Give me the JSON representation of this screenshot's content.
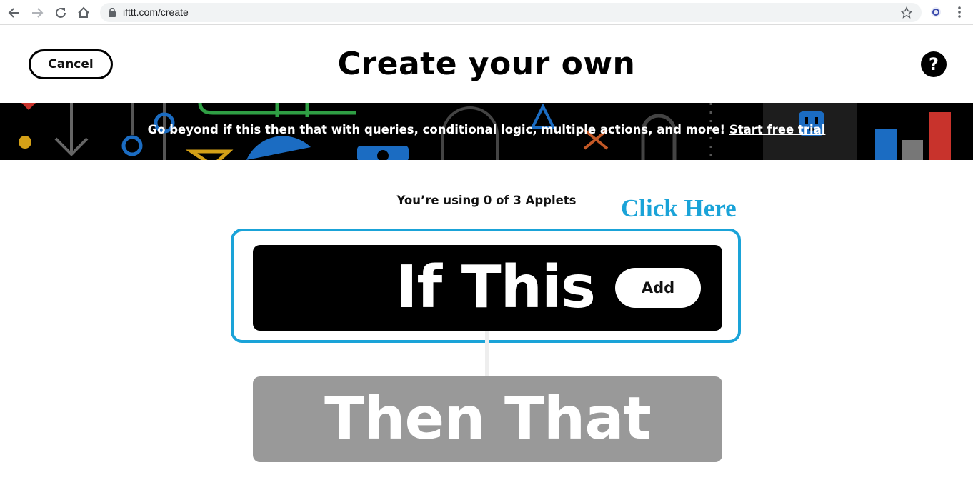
{
  "browser": {
    "url": "ifttt.com/create",
    "icons": [
      "back-icon",
      "forward-icon",
      "reload-icon",
      "home-icon",
      "lock-icon",
      "star-icon",
      "extension-icon",
      "menu-icon"
    ]
  },
  "header": {
    "cancel_label": "Cancel",
    "title": "Create your own",
    "help_label": "?"
  },
  "promo": {
    "text": "Go beyond if this then that with queries, conditional logic, multiple actions, and more!",
    "link_label": "Start free trial"
  },
  "builder": {
    "usage_text": "You’re using 0 of 3 Applets",
    "annotation": "Click Here",
    "trigger_label": "If This",
    "add_label": "Add",
    "action_label": "Then That"
  },
  "colors": {
    "annotation": "#1aa3d8",
    "trigger_bg": "#000000",
    "action_bg": "#999999",
    "banner_bg": "#000000"
  }
}
